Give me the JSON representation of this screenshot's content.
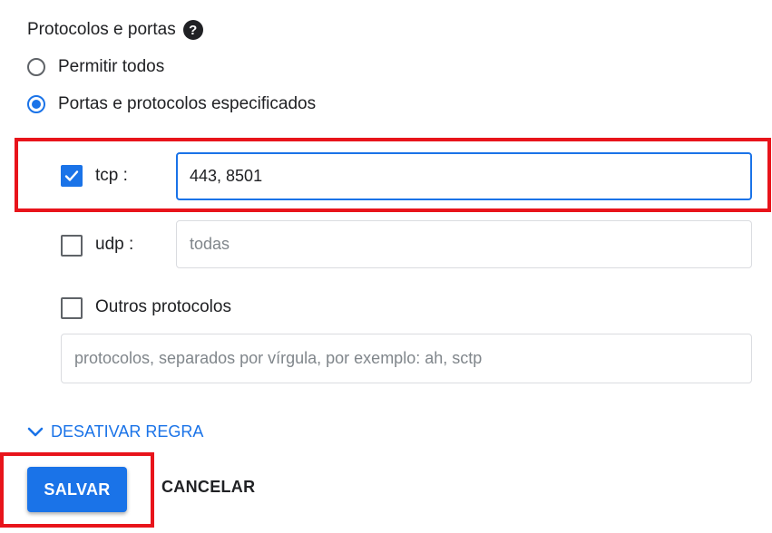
{
  "section": {
    "title": "Protocolos e portas",
    "help_icon": "help-circle-icon"
  },
  "options": {
    "allow_all_label": "Permitir todos",
    "specified_label": "Portas e protocolos especificados",
    "selected": "specified"
  },
  "tcp": {
    "checked": true,
    "label": "tcp :",
    "value": "443, 8501"
  },
  "udp": {
    "checked": false,
    "label": "udp :",
    "placeholder": "todas"
  },
  "other": {
    "checked": false,
    "label": "Outros protocolos",
    "placeholder": "protocolos, separados por vírgula, por exemplo: ah, sctp"
  },
  "collapse_link": {
    "label": "DESATIVAR REGRA",
    "icon": "chevron-down-icon"
  },
  "actions": {
    "save_label": "SALVAR",
    "cancel_label": "CANCELAR"
  },
  "colors": {
    "accent": "#1a73e8",
    "highlight": "#e8141b",
    "text": "#202124"
  }
}
